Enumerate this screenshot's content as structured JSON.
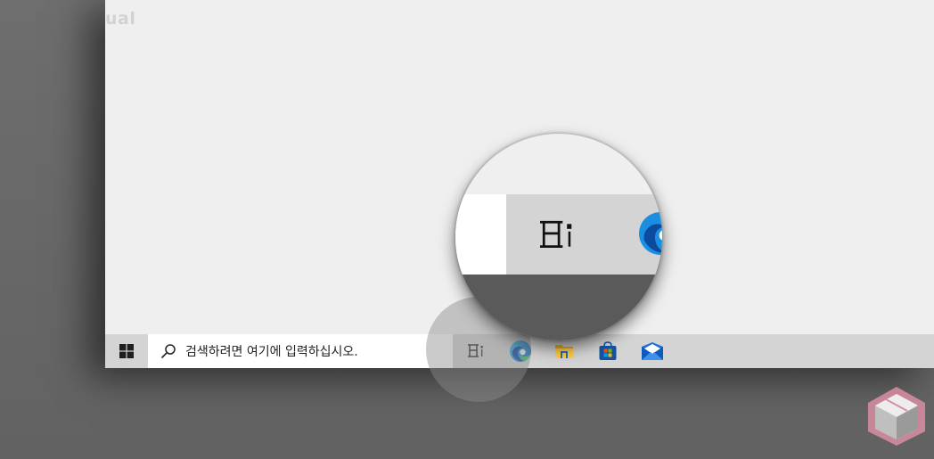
{
  "watermark": {
    "text": "ual"
  },
  "taskbar": {
    "start_icon": "windows-logo-icon",
    "search": {
      "placeholder": "검색하려면 여기에 입력하십시오.",
      "icon": "search-icon"
    },
    "pinned": [
      {
        "name": "task-view",
        "icon": "task-view-icon"
      },
      {
        "name": "edge",
        "icon": "edge-icon"
      },
      {
        "name": "file-explorer",
        "icon": "folder-icon"
      },
      {
        "name": "microsoft-store",
        "icon": "store-icon"
      },
      {
        "name": "mail",
        "icon": "mail-icon"
      }
    ]
  },
  "magnifier": {
    "subject": "task-view-icon"
  },
  "colors": {
    "taskbar": "#d4d4d4",
    "window": "#efefef",
    "accent_blue": "#0078d7",
    "logo_pink": "#d98ea3"
  }
}
